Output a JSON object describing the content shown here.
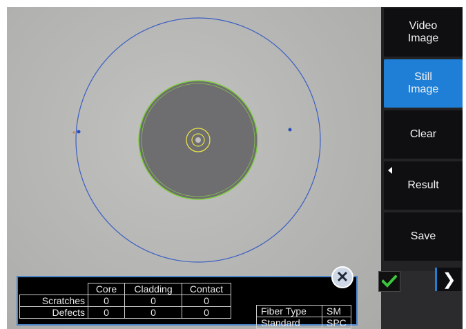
{
  "colors": {
    "accent": "#1f7fd6",
    "outer_ring": "#3a5fc4",
    "cladding_ring": "#7ccc3a",
    "core_ring": "#e8e04a",
    "ok_check": "#3cc63c"
  },
  "side_buttons": [
    {
      "label": "Video\nImage",
      "active": false
    },
    {
      "label": "Still\nImage",
      "active": true
    },
    {
      "label": "Clear",
      "active": false
    },
    {
      "label": "Result",
      "active": false
    },
    {
      "label": "Save",
      "active": false
    }
  ],
  "results": {
    "headers": [
      "Core",
      "Cladding",
      "Contact"
    ],
    "rows": [
      {
        "label": "Scratches",
        "values": [
          "0",
          "0",
          "0"
        ]
      },
      {
        "label": "Defects",
        "values": [
          "0",
          "0",
          "0"
        ]
      }
    ]
  },
  "fiber": {
    "type_label": "Fiber Type",
    "type_value": "SM",
    "standard_label": "Standard",
    "standard_value": "SPC"
  },
  "icons": {
    "close": "close-icon",
    "check": "checkmark-icon",
    "next": "chevron-right-icon",
    "result_indicator": "triangle-left-icon"
  },
  "glyphs": {
    "close": "✕",
    "next": "❯"
  }
}
